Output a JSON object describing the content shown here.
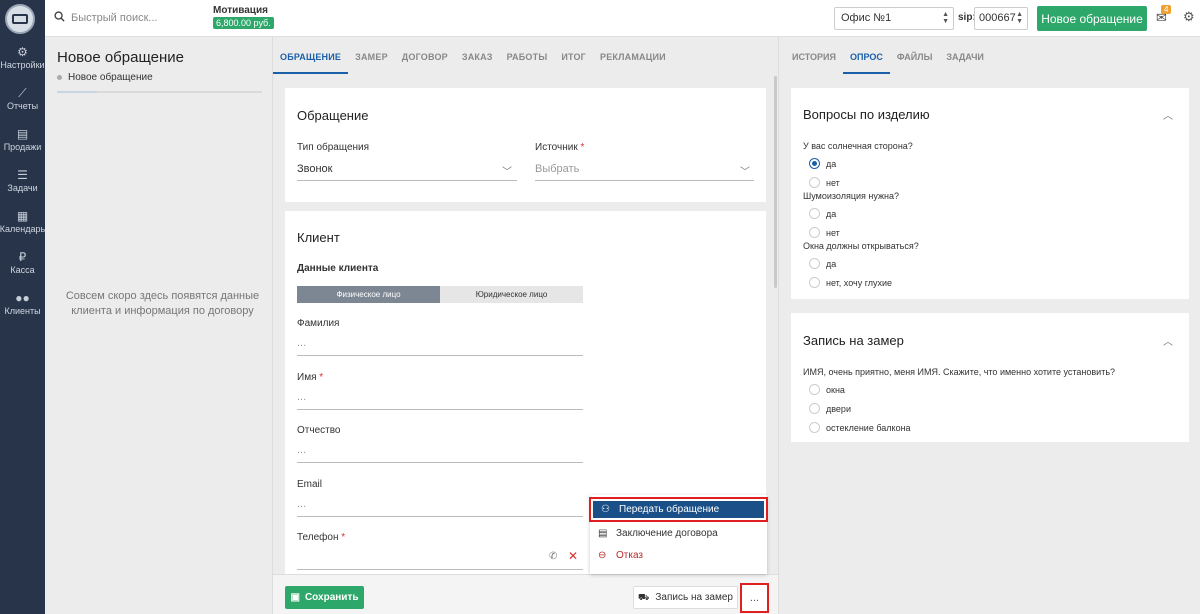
{
  "sidebar": {
    "items": [
      {
        "label": "Настройки",
        "icon": "gear-icon",
        "glyph": "⚙"
      },
      {
        "label": "Отчеты",
        "icon": "chart-icon",
        "glyph": "📈"
      },
      {
        "label": "Продажи",
        "icon": "document-icon",
        "glyph": "🗎"
      },
      {
        "label": "Задачи",
        "icon": "list-icon",
        "glyph": "☰"
      },
      {
        "label": "Календарь",
        "icon": "calendar-icon",
        "glyph": "📅"
      },
      {
        "label": "Касса",
        "icon": "ruble-icon",
        "glyph": "₽"
      },
      {
        "label": "Клиенты",
        "icon": "users-icon",
        "glyph": "👥"
      }
    ]
  },
  "topbar": {
    "search_placeholder": "Быстрый поиск...",
    "motivation_title": "Мотивация",
    "motivation_value": "6,800.00 руб.",
    "office": "Офис №1",
    "sip_label": "sip:",
    "sip_value": "000667",
    "new_button": "Новое обращение",
    "notifications_count": "4",
    "accent_color": "#2ea86a"
  },
  "left_panel": {
    "title": "Новое обращение",
    "step": "Новое обращение",
    "empty_text": "Совсем скоро здесь появятся данные клиента и информация по договору"
  },
  "center": {
    "tabs": [
      "ОБРАЩЕНИЕ",
      "ЗАМЕР",
      "ДОГОВОР",
      "ЗАКАЗ",
      "РАБОТЫ",
      "ИТОГ",
      "РЕКЛАМАЦИИ"
    ],
    "active_tab": "ОБРАЩЕНИЕ",
    "appeal": {
      "title": "Обращение",
      "type_label": "Тип обращения",
      "type_value": "Звонок",
      "source_label": "Источник",
      "source_placeholder": "Выбрать"
    },
    "client": {
      "title": "Клиент",
      "subtitle": "Данные клиента",
      "seg_physical": "Физическое лицо",
      "seg_legal": "Юридическое лицо",
      "surname_label": "Фамилия",
      "surname_placeholder": "...",
      "name_label": "Имя",
      "name_placeholder": "...",
      "patronymic_label": "Отчество",
      "patronymic_placeholder": "...",
      "email_label": "Email",
      "email_placeholder": "...",
      "phone_label": "Телефон",
      "required_mark": "*"
    },
    "footer": {
      "save": "Сохранить",
      "zamer": "Запись на замер",
      "more": "..."
    },
    "dropdown": {
      "transfer": "Передать обращение",
      "contract": "Заключение договора",
      "refuse": "Отказ"
    }
  },
  "right": {
    "tabs": [
      "ИСТОРИЯ",
      "ОПРОС",
      "ФАЙЛЫ",
      "ЗАДАЧИ"
    ],
    "active_tab": "ОПРОС",
    "product_questions": {
      "title": "Вопросы по изделию",
      "q1": "У вас солнечная сторона?",
      "q1_options": [
        "да",
        "нет"
      ],
      "q1_selected": "да",
      "q2": "Шумоизоляция нужна?",
      "q2_options": [
        "да",
        "нет"
      ],
      "q3": "Окна должны открываться?",
      "q3_options": [
        "да",
        "нет, хочу глухие"
      ]
    },
    "measurement": {
      "title": "Запись на замер",
      "question": "ИМЯ, очень приятно, меня ИМЯ. Скажите, что именно хотите установить?",
      "options": [
        "окна",
        "двери",
        "остекление балкона"
      ]
    }
  }
}
